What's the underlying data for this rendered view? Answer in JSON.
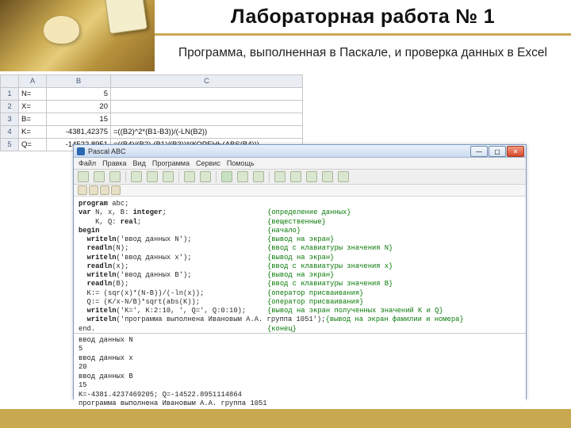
{
  "header": {
    "title": "Лабораторная работа № 1",
    "subtitle": "Программа, выполненная в Паскале, и проверка данных в Excel"
  },
  "excel": {
    "cols": [
      "",
      "A",
      "B",
      "C"
    ],
    "rows": [
      {
        "n": "1",
        "a": "N=",
        "b": "5",
        "c": ""
      },
      {
        "n": "2",
        "a": "X=",
        "b": "20",
        "c": ""
      },
      {
        "n": "3",
        "a": "B=",
        "b": "15",
        "c": ""
      },
      {
        "n": "4",
        "a": "K=",
        "b": "-4381,42375",
        "c": "=((B2)^2*(B1-B3))/(-LN(B2))"
      },
      {
        "n": "5",
        "a": "Q=",
        "b": "-14522,8951",
        "c": "=((B4)/(B2)-(B1)/(B3))*(КОРЕНЬ(ABS(B4)))"
      }
    ]
  },
  "ide": {
    "title": "Pascal ABC",
    "menu": [
      "Файл",
      "Правка",
      "Вид",
      "Программа",
      "Сервис",
      "Помощь"
    ],
    "code": [
      {
        "l": "program abc;",
        "c": ""
      },
      {
        "l": "var N, x, B: integer;",
        "c": "{определение данных}"
      },
      {
        "l": "    K, Q: real;",
        "c": "{вещественные}"
      },
      {
        "l": "begin",
        "c": "{начало}"
      },
      {
        "l": "  writeln('ввод данных N');",
        "c": "{вывод на экран}"
      },
      {
        "l": "  readln(N);",
        "c": "{ввод с клавиатуры значения N}"
      },
      {
        "l": "  writeln('ввод данных x');",
        "c": "{вывод на экран}"
      },
      {
        "l": "  readln(x);",
        "c": "{ввод с клавиатуры значения x}"
      },
      {
        "l": "  writeln('ввод данных B');",
        "c": "{вывод на экран}"
      },
      {
        "l": "  readln(B);",
        "c": "{ввод с клавиатуры значения B}"
      },
      {
        "l": "  K:= (sqr(x)*(N-B))/(-ln(x));",
        "c": "{оператор присваивания}"
      },
      {
        "l": "  Q:= (K/x-N/B)*sqrt(abs(K));",
        "c": "{оператор присваивания}"
      },
      {
        "l": "  writeln('K=', K:2:10, ', Q=', Q:0:10);",
        "c": "{вывод на экран полученных значений K и Q}"
      },
      {
        "l": "  writeln('программа выполнена Ивановым А.А. группа 1051');",
        "c": "{вывод на экран фамилии и номера}"
      },
      {
        "l": "end.",
        "c": "{конец}"
      }
    ],
    "output": [
      "ввод данных N",
      "5",
      "ввод данных x",
      "20",
      "ввод данных B",
      "15",
      "K=-4381.4237469205; Q=-14522.8951114864",
      "программа выполнена Ивановым А.А. группа 1051"
    ]
  }
}
